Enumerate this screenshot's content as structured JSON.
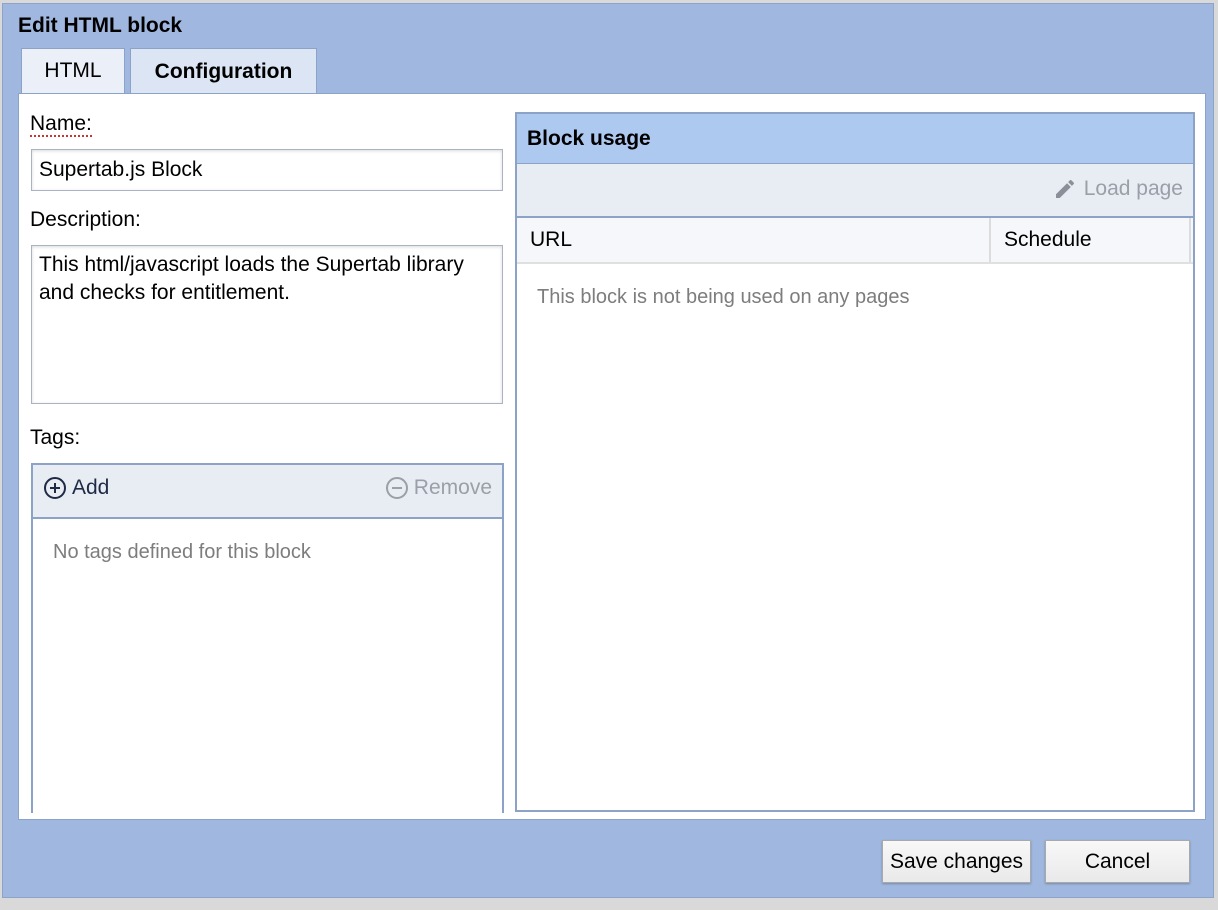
{
  "dialog": {
    "title": "Edit HTML block"
  },
  "tabs": [
    {
      "label": "HTML",
      "active": false
    },
    {
      "label": "Configuration",
      "active": true
    }
  ],
  "form": {
    "name_label": "Name:",
    "name_value": "Supertab.js Block",
    "description_label": "Description:",
    "description_value": "This html/javascript loads the Supertab library and checks for entitlement.",
    "tags_label": "Tags:"
  },
  "tags": {
    "add_label": "Add",
    "remove_label": "Remove",
    "empty_text": "No tags defined for this block"
  },
  "usage": {
    "header": "Block usage",
    "load_label": "Load page",
    "columns": [
      "URL",
      "Schedule"
    ],
    "empty_text": "This block is not being used on any pages"
  },
  "footer": {
    "save_label": "Save changes",
    "cancel_label": "Cancel"
  },
  "colors": {
    "dialog_bg": "#a0b8e0",
    "usage_header_bg": "#adc9f0",
    "border": "#8da2c7"
  },
  "icons": {
    "add": "plus-circle-icon",
    "remove": "minus-circle-icon",
    "load": "pencil-icon"
  }
}
